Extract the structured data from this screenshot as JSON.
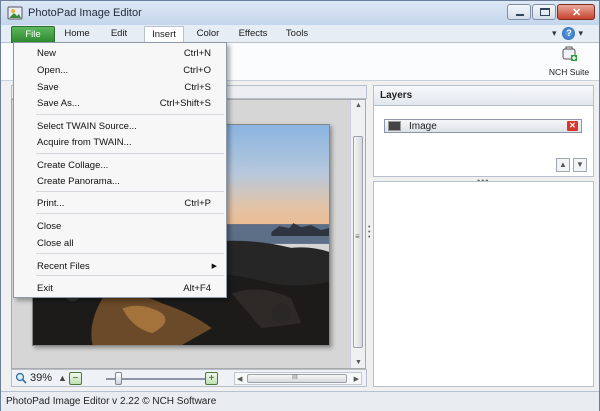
{
  "window": {
    "title": "PhotoPad Image Editor",
    "controls": {
      "minimize": "minimize",
      "maximize": "maximize",
      "close": "x"
    }
  },
  "ribbon": {
    "tabs": [
      {
        "label": "File",
        "state": "file"
      },
      {
        "label": "Home",
        "state": "normal"
      },
      {
        "label": "Edit",
        "state": "normal"
      },
      {
        "label": "Insert",
        "state": "active"
      },
      {
        "label": "Color",
        "state": "normal"
      },
      {
        "label": "Effects",
        "state": "normal"
      },
      {
        "label": "Tools",
        "state": "normal"
      }
    ],
    "help_label": "?",
    "nch_suite_label": "NCH Suite"
  },
  "file_menu": {
    "groups": [
      [
        {
          "label": "New",
          "shortcut": "Ctrl+N"
        },
        {
          "label": "Open...",
          "shortcut": "Ctrl+O"
        },
        {
          "label": "Save",
          "shortcut": "Ctrl+S"
        },
        {
          "label": "Save As...",
          "shortcut": "Ctrl+Shift+S"
        }
      ],
      [
        {
          "label": "Select TWAIN Source...",
          "shortcut": ""
        },
        {
          "label": "Acquire from TWAIN...",
          "shortcut": ""
        }
      ],
      [
        {
          "label": "Create Collage...",
          "shortcut": ""
        },
        {
          "label": "Create Panorama...",
          "shortcut": ""
        }
      ],
      [
        {
          "label": "Print...",
          "shortcut": "Ctrl+P"
        }
      ],
      [
        {
          "label": "Close",
          "shortcut": ""
        },
        {
          "label": "Close all",
          "shortcut": ""
        }
      ],
      [
        {
          "label": "Recent Files",
          "shortcut": "",
          "submenu": true
        }
      ],
      [
        {
          "label": "Exit",
          "shortcut": "Alt+F4"
        }
      ]
    ]
  },
  "canvas": {
    "zoom_label": "39%",
    "zoom_percent": 39,
    "hscroll_label": "III",
    "vscroll_label": "≡"
  },
  "layers": {
    "header": "Layers",
    "items": [
      {
        "name": "Image"
      }
    ]
  },
  "statusbar": {
    "text": "PhotoPad Image Editor v 2.22 © NCH Software"
  }
}
